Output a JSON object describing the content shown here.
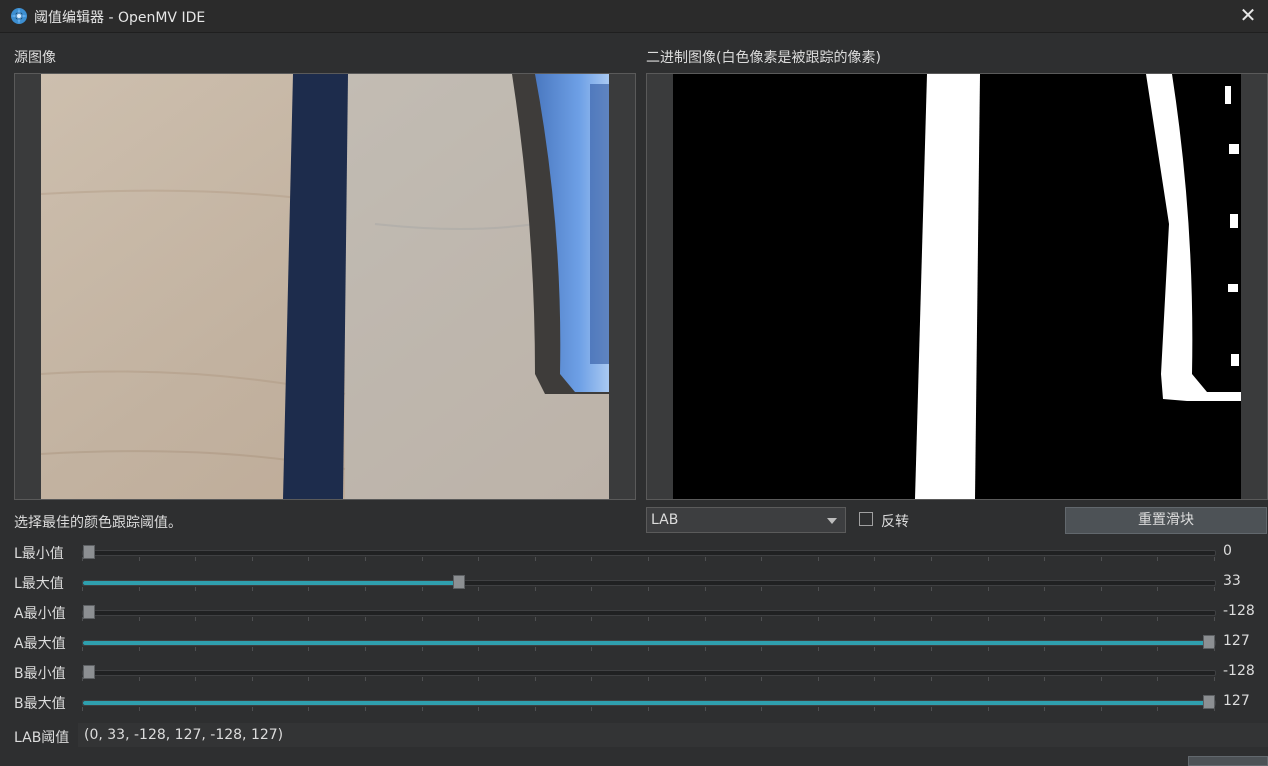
{
  "window": {
    "title": "阈值编辑器 - OpenMV IDE",
    "close_label": "✕"
  },
  "source_panel": {
    "label": "源图像"
  },
  "binary_panel": {
    "label": "二进制图像(白色像素是被跟踪的像素)"
  },
  "instruction": "选择最佳的颜色跟踪阈值。",
  "color_space": {
    "selected": "LAB"
  },
  "invert": {
    "label": "反转",
    "checked": false
  },
  "reset_button": {
    "label": "重置滑块"
  },
  "sliders": [
    {
      "name": "L最小值",
      "value": "0",
      "min": 0,
      "max": 100
    },
    {
      "name": "L最大值",
      "value": "33",
      "min": 0,
      "max": 100
    },
    {
      "name": "A最小值",
      "value": "-128",
      "min": -128,
      "max": 127
    },
    {
      "name": "A最大值",
      "value": "127",
      "min": -128,
      "max": 127
    },
    {
      "name": "B最小值",
      "value": "-128",
      "min": -128,
      "max": 127
    },
    {
      "name": "B最大值",
      "value": "127",
      "min": -128,
      "max": 127
    }
  ],
  "lab_threshold": {
    "label": "LAB阈值",
    "value": "(0, 33, -128, 127, -128, 127)"
  },
  "colors": {
    "accent": "#2f9fae",
    "background": "#2e2f30"
  }
}
